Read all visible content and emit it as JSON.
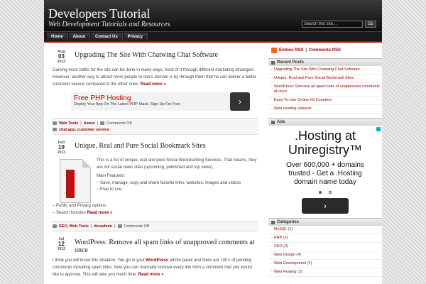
{
  "site": {
    "title": "Developers Tutorial",
    "description": "Web Development Tutorials and Resources"
  },
  "search": {
    "placeholder": "Search this site...",
    "button": "Go"
  },
  "nav": [
    "Home",
    "About",
    "Contact Us",
    "Privacy"
  ],
  "posts": [
    {
      "month": "Aug",
      "day": "03",
      "year": "2013",
      "title": "Upgrading The Site With Chatwing Chat Software",
      "excerpt": "Gaining more traffic for the site can be done in many ways, most of it through different marketing strategies. However, another way to attract more people to one's domain is by through them that he can deliver a better customer service compared to the other ones.",
      "more": "Read more »",
      "ad": {
        "title": "Free PHP Hosting",
        "sub": "Deploy Your App On The Latest PHP Stack. Sign Up For Free",
        "arrow": "›"
      },
      "meta": {
        "cats": "Web Tools",
        "author": "Aaron",
        "comments": "Comments Off",
        "tags": "chat app, customer service"
      }
    },
    {
      "month": "Feb",
      "day": "19",
      "year": "2013",
      "title": "Unique, Real and Pure Social Bookmark Sites",
      "p1": "This is a list of unique, real and pure Social Bookmarking Services. That means, they are not social news sites (upcoming, published and top news).",
      "features_label": "Main Features:",
      "f1": "– Save, manage, copy and share favorite links, websites, images and videos",
      "f2": "– Free to use",
      "f3": "– Public and Privacy options",
      "f4": "– Search function",
      "more": "Read more »",
      "meta": {
        "cats": "SEO, Web Tools",
        "author": "devadmin",
        "comments": "Comments Off"
      }
    },
    {
      "month": "Jul",
      "day": "12",
      "year": "2012",
      "title": "WordPress: Remove all spam links of unapproved comments at once",
      "excerpt_a": "I think you will know this situation: You go to your ",
      "excerpt_link": "WordPress",
      "excerpt_b": " admin panel and there are 100's of pending comments including spam links. Now you can manually remove every link from a comment that you would like to approve. This will take you much time.",
      "more": "Read more »"
    }
  ],
  "sidebar": {
    "feeds": {
      "entries": "Entries RSS",
      "sep": " | ",
      "comments": "Comments RSS"
    },
    "recent_title": "Recent Posts",
    "recent": [
      "Upgrading The Site With Chatwing Chat Software",
      "Unique, Real and Pure Social Bookmark Sites",
      "WordPress: Remove all spam links of unapproved comments at once",
      "Easy-To-Use Online Hit Counters",
      "Web Hosting Variants"
    ],
    "ads_title": "Ads",
    "ad": {
      "h1a": ".Hosting at",
      "h1b": "Uniregistry™",
      "h2a": "Over 600,000 + domains",
      "h2b": "trusted - Get a .Hosting",
      "h2c": "domain name today",
      "arrow": "›"
    },
    "categories_title": "Categories",
    "categories": [
      {
        "name": "MySQL",
        "count": "(1)"
      },
      {
        "name": "PHP",
        "count": "(3)"
      },
      {
        "name": "SEO",
        "count": "(3)"
      },
      {
        "name": "Web Design",
        "count": "(4)"
      },
      {
        "name": "Web Development",
        "count": "(5)"
      },
      {
        "name": "Web Hosting",
        "count": "(2)"
      }
    ]
  },
  "colors": {
    "accent": "#990000",
    "header": "#111111",
    "nav_border": "#bb0000"
  }
}
